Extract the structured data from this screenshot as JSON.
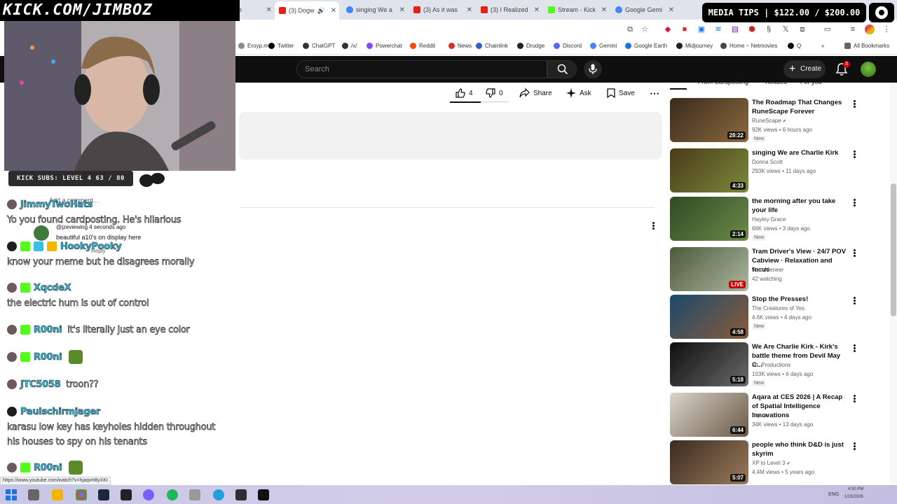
{
  "overlay": {
    "watermark": "KICK.COM/JIMBOZ",
    "media_tips": "MEDIA TIPS | $122.00 / $200.00",
    "kick_subs": "KICK SUBS: LEVEL 4 63 / 80"
  },
  "browser": {
    "tabs": [
      {
        "label": "e",
        "favicon_color": "#e62117"
      },
      {
        "label": "(3) Dogw",
        "favicon_color": "#e62117",
        "active": true
      },
      {
        "label": "singing We a",
        "favicon_color": "#4285f4"
      },
      {
        "label": "(3) As it was",
        "favicon_color": "#e62117"
      },
      {
        "label": "(3) I Realized",
        "favicon_color": "#e62117"
      },
      {
        "label": "Stream - Kick",
        "favicon_color": "#53fc18"
      },
      {
        "label": "Google Gemi",
        "favicon_color": "#4285f4"
      }
    ],
    "bookmarks": [
      {
        "label": "Eroyp.me",
        "color": "#8a8a8a"
      },
      {
        "label": "Twitter",
        "color": "#000000"
      },
      {
        "label": "ChatGPT",
        "color": "#333333"
      },
      {
        "label": "/x/",
        "color": "#333333"
      },
      {
        "label": "Powerchat",
        "color": "#7c4dff"
      },
      {
        "label": "Reddit",
        "color": "#ff4500"
      },
      {
        "label": "News",
        "color": "#d93025"
      },
      {
        "label": "Chainlink",
        "color": "#375bd2"
      },
      {
        "label": "Drudge",
        "color": "#222222"
      },
      {
        "label": "Discord",
        "color": "#5865f2"
      },
      {
        "label": "Gemini",
        "color": "#4285f4"
      },
      {
        "label": "Google Earth",
        "color": "#1a73e8"
      },
      {
        "label": "Midjourney",
        "color": "#222222"
      },
      {
        "label": "Home ~ Netmovies",
        "color": "#444444"
      },
      {
        "label": "Q",
        "color": "#111111"
      }
    ],
    "all_bookmarks": "All Bookmarks",
    "status_url": "https://www.youtube.com/watch?v=hjaqvH8yXKI"
  },
  "youtube": {
    "search_placeholder": "Search",
    "create_label": "Create",
    "notification_count": "3",
    "actions": {
      "likes": "4",
      "dislikes": "0",
      "share": "Share",
      "ask": "Ask",
      "save": "Save"
    },
    "add_comment": "Add a comment...",
    "sample_comment": {
      "handle": "@jzeviewing  4 seconds ago",
      "text": "beautiful a10's on display here",
      "reply": "Reply"
    },
    "chips": [
      "From Cardposting",
      "Related",
      "For you"
    ],
    "recommendations": [
      {
        "title": "The Roadmap That Changes RuneScape Forever",
        "channel": "RuneScape",
        "verified": true,
        "meta": "92K views • 6 hours ago",
        "badge": "New",
        "duration": "28:22",
        "thumb": [
          "#3a2a1e",
          "#8b6a3d"
        ]
      },
      {
        "title": "singing We are Charlie Kirk",
        "channel": "Donna Scott",
        "verified": false,
        "meta": "293K views • 11 days ago",
        "badge": "",
        "duration": "4:33",
        "thumb": [
          "#4a3a1a",
          "#7a8a3a"
        ]
      },
      {
        "title": "the morning after you take your life",
        "channel": "Hayley Grace",
        "verified": false,
        "meta": "66K views • 3 days ago",
        "badge": "New",
        "duration": "2:14",
        "thumb": [
          "#2f4a22",
          "#6d8a4c"
        ]
      },
      {
        "title": "Tram Driver's View · 24/7 POV Cabview · Relaxation and focus",
        "channel": "TramMeneer",
        "verified": false,
        "meta": "42 watching",
        "badge": "",
        "duration": "LIVE",
        "thumb": [
          "#4d5a3a",
          "#a9b7a0"
        ]
      },
      {
        "title": "Stop the Presses!",
        "channel": "The Creatures of Yes",
        "verified": false,
        "meta": "4.6K views • 4 days ago",
        "badge": "New",
        "duration": "4:58",
        "thumb": [
          "#1b4a6b",
          "#8a5a3a"
        ]
      },
      {
        "title": "We Are Charlie Kirk - Kirk's battle theme from Devil May C...",
        "channel": "ML Productions",
        "verified": false,
        "meta": "103K views • 6 days ago",
        "badge": "New",
        "duration": "5:18",
        "thumb": [
          "#0e0e0e",
          "#6a6a6a"
        ]
      },
      {
        "title": "Aqara at CES 2026 | A Recap of Spatial Intelligence Innovations",
        "channel": "Aqara",
        "verified": false,
        "meta": "34K views • 13 days ago",
        "badge": "",
        "duration": "6:44",
        "thumb": [
          "#d9d4cc",
          "#6b5a45"
        ]
      },
      {
        "title": "people who think D&D is just skyrim",
        "channel": "XP to Level 3",
        "verified": true,
        "meta": "4.4M views • 5 years ago",
        "badge": "",
        "duration": "5:07",
        "thumb": [
          "#3a2a22",
          "#9a7a5a"
        ]
      }
    ]
  },
  "chat": [
    {
      "user": "JimmyTwoHats",
      "text": "Yo you found cardposting. He's hilarious",
      "newline": true
    },
    {
      "user": "HookyPooky",
      "text": "know your meme but he disagrees morally",
      "newline": true
    },
    {
      "user": "XqcdeX",
      "text": "the electric hum is out of control",
      "newline": true
    },
    {
      "user": "R00ni",
      "text": "it's literally just an eye color",
      "newline": false
    },
    {
      "user": "R00ni",
      "text": "",
      "newline": false
    },
    {
      "user": "JTC5058",
      "text": "troon??",
      "newline": false
    },
    {
      "user": "Paulschirmjager",
      "text": "karasu low key has keyholes hidden throughout his houses to spy on his tenants",
      "newline": true
    },
    {
      "user": "R00ni",
      "text": "",
      "newline": false
    }
  ],
  "taskbar": {
    "lang": "ENG",
    "time": "4:30 PM",
    "date": "1/19/2026"
  },
  "colors": {
    "chat_username": "#33c3e8",
    "kick_green": "#53fc18",
    "yt_dark": "#0f0f0f"
  }
}
